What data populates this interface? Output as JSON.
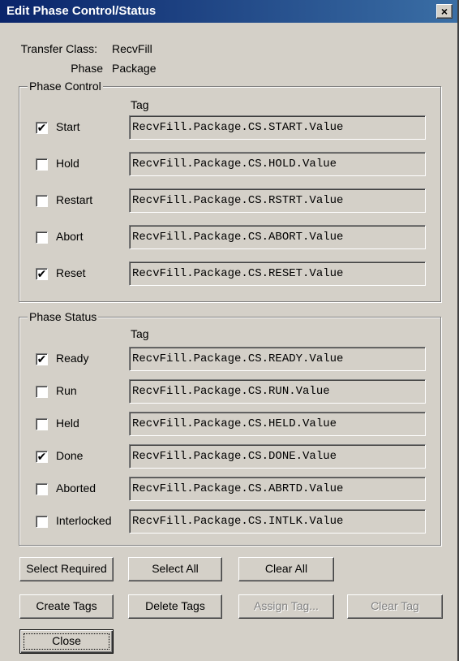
{
  "window": {
    "title": "Edit Phase Control/Status",
    "close_glyph": "×"
  },
  "info": {
    "transfer_class_label": "Transfer Class:",
    "transfer_class_value": "RecvFill",
    "phase_label": "Phase",
    "phase_value": "Package"
  },
  "phase_control": {
    "title": "Phase Control",
    "tag_header": "Tag",
    "rows": [
      {
        "label": "Start",
        "checked": true,
        "tag": "RecvFill.Package.CS.START.Value"
      },
      {
        "label": "Hold",
        "checked": false,
        "tag": "RecvFill.Package.CS.HOLD.Value"
      },
      {
        "label": "Restart",
        "checked": false,
        "tag": "RecvFill.Package.CS.RSTRT.Value"
      },
      {
        "label": "Abort",
        "checked": false,
        "tag": "RecvFill.Package.CS.ABORT.Value"
      },
      {
        "label": "Reset",
        "checked": true,
        "tag": "RecvFill.Package.CS.RESET.Value"
      }
    ]
  },
  "phase_status": {
    "title": "Phase Status",
    "tag_header": "Tag",
    "rows": [
      {
        "label": "Ready",
        "checked": true,
        "tag": "RecvFill.Package.CS.READY.Value"
      },
      {
        "label": "Run",
        "checked": false,
        "tag": "RecvFill.Package.CS.RUN.Value"
      },
      {
        "label": "Held",
        "checked": false,
        "tag": "RecvFill.Package.CS.HELD.Value"
      },
      {
        "label": "Done",
        "checked": true,
        "tag": "RecvFill.Package.CS.DONE.Value"
      },
      {
        "label": "Aborted",
        "checked": false,
        "tag": "RecvFill.Package.CS.ABRTD.Value"
      },
      {
        "label": "Interlocked",
        "checked": false,
        "tag": "RecvFill.Package.CS.INTLK.Value"
      }
    ]
  },
  "buttons": {
    "select_required": "Select Required",
    "select_all": "Select All",
    "clear_all": "Clear All",
    "create_tags": "Create Tags",
    "delete_tags": "Delete Tags",
    "assign_tag": "Assign Tag...",
    "clear_tag": "Clear Tag",
    "close": "Close"
  },
  "checkmark_glyph": "✔"
}
